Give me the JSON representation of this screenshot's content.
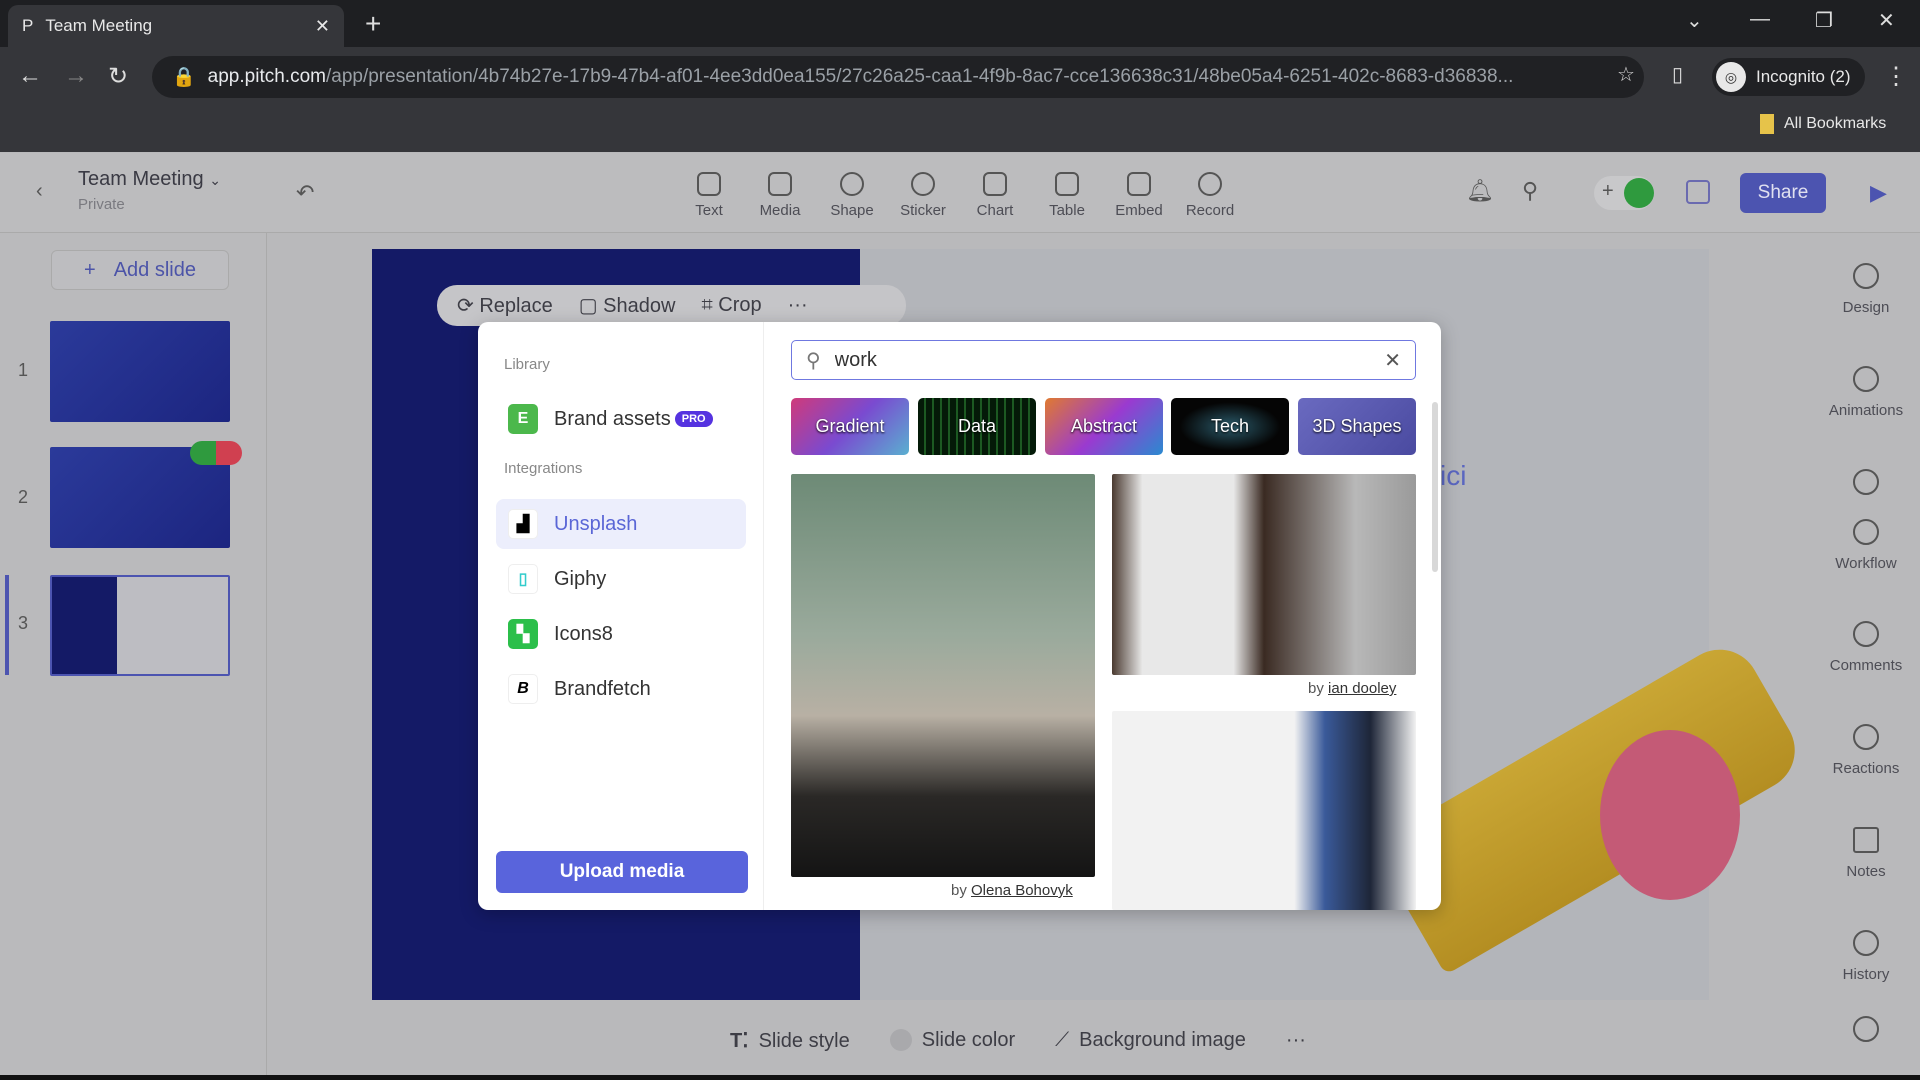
{
  "browser": {
    "tab_title": "Team Meeting",
    "url_host": "app.pitch.com",
    "url_path": "/app/presentation/4b74b27e-17b9-47b4-af01-4ee3dd0ea155/27c26a25-caa1-4f9b-8ac7-cce136638c31/48be05a4-6251-402c-8683-d36838...",
    "profile": "Incognito (2)",
    "bookmarks": "All Bookmarks"
  },
  "header": {
    "title": "Team Meeting",
    "subtitle": "Private",
    "share": "Share",
    "tools": [
      {
        "label": "Text"
      },
      {
        "label": "Media"
      },
      {
        "label": "Shape"
      },
      {
        "label": "Sticker"
      },
      {
        "label": "Chart"
      },
      {
        "label": "Table"
      },
      {
        "label": "Embed"
      },
      {
        "label": "Record"
      }
    ]
  },
  "sidebar": {
    "add_slide": "Add slide",
    "slides": [
      {
        "num": "1"
      },
      {
        "num": "2"
      },
      {
        "num": "3"
      }
    ]
  },
  "image_toolbar": {
    "replace": "Replace",
    "shadow": "Shadow",
    "crop": "Crop",
    "more": "···"
  },
  "media_panel": {
    "library_label": "Library",
    "brand_assets": "Brand assets",
    "pro": "PRO",
    "integrations_label": "Integrations",
    "integrations": [
      {
        "label": "Unsplash"
      },
      {
        "label": "Giphy"
      },
      {
        "label": "Icons8"
      },
      {
        "label": "Brandfetch"
      }
    ],
    "upload": "Upload media",
    "search_value": "work",
    "chips": [
      {
        "label": "Gradient"
      },
      {
        "label": "Data"
      },
      {
        "label": "Abstract"
      },
      {
        "label": "Tech"
      },
      {
        "label": "3D Shapes"
      }
    ],
    "photos": [
      {
        "by": "by ",
        "author": "Olena Bohovyk"
      },
      {
        "by": "by ",
        "author": "ian dooley"
      }
    ]
  },
  "slide": {
    "partial_text": "ici"
  },
  "bottom_toolbar": {
    "slide_style": "Slide style",
    "slide_color": "Slide color",
    "background_image": "Background image",
    "more": "···"
  },
  "right_sidebar": [
    {
      "label": "Design"
    },
    {
      "label": "Animations"
    },
    {
      "label": "Workflow"
    },
    {
      "label": "Comments"
    },
    {
      "label": "Reactions"
    },
    {
      "label": "Notes"
    },
    {
      "label": "History"
    }
  ],
  "colors": {
    "accent": "#5964dc",
    "slide_blue": "#141a66"
  }
}
